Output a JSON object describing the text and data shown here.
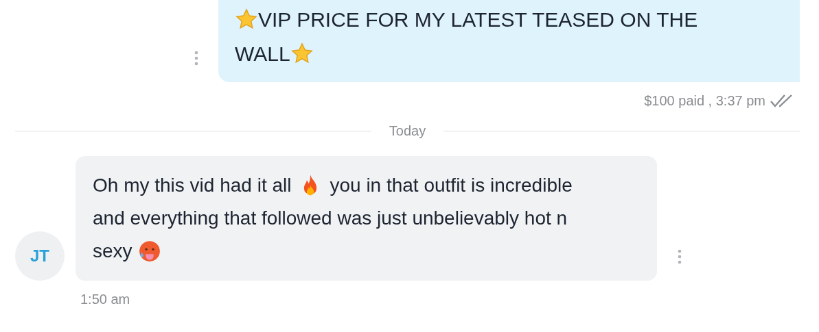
{
  "messages": [
    {
      "kind": "outgoing",
      "lines": [
        [
          {
            "kind": "star"
          },
          {
            "kind": "text",
            "text": "VIP PRICE FOR MY LATEST TEASED ON THE"
          }
        ],
        [
          {
            "kind": "text",
            "text": "WALL"
          },
          {
            "kind": "star"
          }
        ]
      ],
      "meta": "$100 paid , 3:37 pm",
      "read": true
    },
    {
      "kind": "divider",
      "text": "Today"
    },
    {
      "kind": "incoming",
      "avatar": "JT",
      "lines": [
        [
          {
            "kind": "text",
            "text": "Oh my this vid had it all"
          },
          {
            "kind": "fire"
          },
          {
            "kind": "text",
            "text": "you in that outfit is incredible"
          }
        ],
        [
          {
            "kind": "text",
            "text": "and everything that followed was just unbelievably hot n"
          }
        ],
        [
          {
            "kind": "text",
            "text": "sexy"
          },
          {
            "kind": "face"
          }
        ]
      ],
      "time": "1:50 am"
    }
  ]
}
